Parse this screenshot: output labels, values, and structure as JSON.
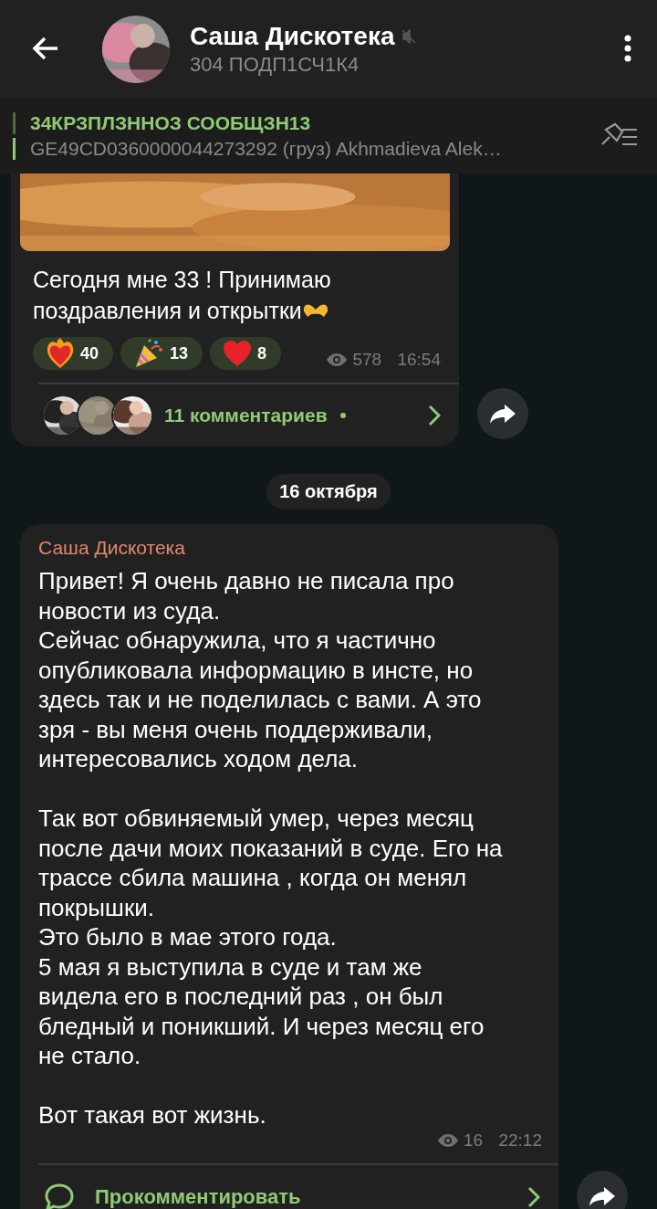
{
  "header": {
    "title": "Саша Дискотека",
    "muted": true,
    "subtitle": "304 ПОДП1СЧ1К4"
  },
  "pinned": {
    "title": "34КРЗПЛЗННОЗ СООБЩЗН13",
    "text": "GE49CD0360000044273292 (груз) Akhmadieva Alek…"
  },
  "messages": [
    {
      "kind": "photo_post",
      "text": "Сегодня мне 33 ! Принимаю поздравления и открытки",
      "reactions": [
        {
          "kind": "fire_heart",
          "count": "40"
        },
        {
          "kind": "party",
          "count": "13"
        },
        {
          "kind": "heart",
          "count": "8"
        }
      ],
      "views": "578",
      "time": "16:54",
      "comments": "11 комментариев",
      "unread": true
    },
    {
      "kind": "text_post",
      "date": "16 октября",
      "author": "Саша Дискотека",
      "text": "Привет! Я очень давно не писала про новости из суда.\nСейчас обнаружила, что я частично опубликовала информацию в инсте, но здесь так и не поделилась с вами. А это зря - вы меня очень поддерживали, интересовались ходом дела.\n\nТак вот обвиняемый умер, через месяц после дачи моих показаний в суде. Его на трассе сбила машина , когда он менял покрышки.\nЭто было в мае этого года.\n5 мая я выступила в суде и там же видела его в последний раз , он был бледный и поникший. И через месяц его не стало.\n\nВот такая вот жизнь.",
      "views": "16",
      "time": "22:12",
      "comments": "Прокомментировать"
    }
  ]
}
